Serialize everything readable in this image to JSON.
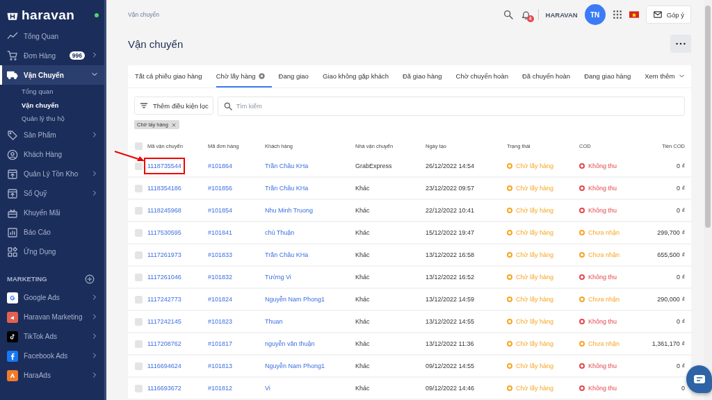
{
  "sidebar": {
    "logo": "haravan",
    "online": true,
    "items": [
      {
        "label": "Tổng Quan",
        "selected": false,
        "expandable": false
      },
      {
        "label": "Đơn Hàng",
        "selected": false,
        "expandable": true,
        "expanded": false,
        "badge": "996"
      },
      {
        "label": "Vận Chuyển",
        "selected": true,
        "expandable": true,
        "expanded": true,
        "children": [
          {
            "label": "Tổng quan",
            "selected": false
          },
          {
            "label": "Vận chuyển",
            "selected": true
          },
          {
            "label": "Quản lý thu hộ",
            "selected": false
          }
        ]
      },
      {
        "label": "Sản Phẩm",
        "selected": false,
        "expandable": true,
        "expanded": false
      },
      {
        "label": "Khách Hàng",
        "selected": false,
        "expandable": false
      },
      {
        "label": "Quản Lý Tồn Kho",
        "selected": false,
        "expandable": true,
        "expanded": false
      },
      {
        "label": "Sổ Quỹ",
        "selected": false,
        "expandable": true,
        "expanded": false
      },
      {
        "label": "Khuyến Mãi",
        "selected": false,
        "expandable": false
      },
      {
        "label": "Báo Cáo",
        "selected": false,
        "expandable": false
      },
      {
        "label": "Ứng Dụng",
        "selected": false,
        "expandable": false
      }
    ],
    "section_title": "MARKETING",
    "apps": [
      {
        "label": "Google Ads"
      },
      {
        "label": "Haravan Marketing"
      },
      {
        "label": "TikTok Ads"
      },
      {
        "label": "Facebook Ads"
      },
      {
        "label": "HaraAds"
      }
    ]
  },
  "topbar": {
    "breadcrumb": "Vận chuyển",
    "notifications": "4",
    "store": "HARAVAN",
    "avatar": "TN",
    "feedback": "Góp ý"
  },
  "page_title": "Vận chuyển",
  "tabs": [
    {
      "label": "Tất cả phiếu giao hàng",
      "selected": false
    },
    {
      "label": "Chờ lấy hàng",
      "selected": true
    },
    {
      "label": "Đang giao",
      "selected": false
    },
    {
      "label": "Giao không gặp khách",
      "selected": false
    },
    {
      "label": "Đã giao hàng",
      "selected": false
    },
    {
      "label": "Chờ chuyển hoàn",
      "selected": false
    },
    {
      "label": "Đã chuyển hoàn",
      "selected": false
    },
    {
      "label": "Đang giao hàng",
      "selected": false
    }
  ],
  "more_tab": "Xem thêm",
  "filter_button": "Thêm điều kiện lọc",
  "search": {
    "placeholder": "Tìm kiếm"
  },
  "chips": [
    "Chờ lấy hàng"
  ],
  "table": {
    "all_checked": false,
    "columns": [
      "Mã vận chuyển",
      "Mã đơn hàng",
      "Khách hàng",
      "Nhà vận chuyển",
      "Ngày tạo",
      "Trạng thái",
      "COD",
      "Tiền COD"
    ],
    "rows": [
      {
        "checked": false,
        "id": "1118735544",
        "order": "#101864",
        "customer": "Trần Châu KHa",
        "carrier": "GrabExpress",
        "date": "26/12/2022 14:54",
        "status": {
          "text": "Chờ lấy hàng",
          "color": "#f5a623"
        },
        "cod": {
          "text": "Không thu",
          "color": "#e5484d"
        },
        "amount": "0 ₫",
        "highlighted": true
      },
      {
        "checked": false,
        "id": "1118354186",
        "order": "#101856",
        "customer": "Trần Châu KHa",
        "carrier": "Khác",
        "date": "23/12/2022 09:57",
        "status": {
          "text": "Chờ lấy hàng",
          "color": "#f5a623"
        },
        "cod": {
          "text": "Không thu",
          "color": "#e5484d"
        },
        "amount": "0 ₫",
        "highlighted": false
      },
      {
        "checked": false,
        "id": "1118245968",
        "order": "#101854",
        "customer": "Nhu Minh Truong",
        "carrier": "Khác",
        "date": "22/12/2022 10:41",
        "status": {
          "text": "Chờ lấy hàng",
          "color": "#f5a623"
        },
        "cod": {
          "text": "Không thu",
          "color": "#e5484d"
        },
        "amount": "0 ₫",
        "highlighted": false
      },
      {
        "checked": false,
        "id": "1117530595",
        "order": "#101841",
        "customer": "chú Thuận",
        "carrier": "Khác",
        "date": "15/12/2022 19:47",
        "status": {
          "text": "Chờ lấy hàng",
          "color": "#f5a623"
        },
        "cod": {
          "text": "Chưa nhận",
          "color": "#f5a623"
        },
        "amount": "299,700 ₫",
        "highlighted": false
      },
      {
        "checked": false,
        "id": "1117261973",
        "order": "#101833",
        "customer": "Trần Châu KHa",
        "carrier": "Khác",
        "date": "13/12/2022 16:58",
        "status": {
          "text": "Chờ lấy hàng",
          "color": "#f5a623"
        },
        "cod": {
          "text": "Chưa nhận",
          "color": "#f5a623"
        },
        "amount": "655,500 ₫",
        "highlighted": false
      },
      {
        "checked": false,
        "id": "1117261046",
        "order": "#101832",
        "customer": "Tường Vi",
        "carrier": "Khác",
        "date": "13/12/2022 16:52",
        "status": {
          "text": "Chờ lấy hàng",
          "color": "#f5a623"
        },
        "cod": {
          "text": "Không thu",
          "color": "#e5484d"
        },
        "amount": "0 ₫",
        "highlighted": false
      },
      {
        "checked": false,
        "id": "1117242773",
        "order": "#101824",
        "customer": "Nguyễn Nam Phong1",
        "carrier": "Khác",
        "date": "13/12/2022 14:59",
        "status": {
          "text": "Chờ lấy hàng",
          "color": "#f5a623"
        },
        "cod": {
          "text": "Chưa nhận",
          "color": "#f5a623"
        },
        "amount": "290,000 ₫",
        "highlighted": false
      },
      {
        "checked": false,
        "id": "1117242145",
        "order": "#101823",
        "customer": "Thuan",
        "carrier": "Khác",
        "date": "13/12/2022 14:55",
        "status": {
          "text": "Chờ lấy hàng",
          "color": "#f5a623"
        },
        "cod": {
          "text": "Không thu",
          "color": "#e5484d"
        },
        "amount": "0 ₫",
        "highlighted": false
      },
      {
        "checked": false,
        "id": "1117208762",
        "order": "#101817",
        "customer": "nguyễn văn thuận",
        "carrier": "Khác",
        "date": "13/12/2022 11:36",
        "status": {
          "text": "Chờ lấy hàng",
          "color": "#f5a623"
        },
        "cod": {
          "text": "Chưa nhận",
          "color": "#f5a623"
        },
        "amount": "1,361,170 ₫",
        "highlighted": false
      },
      {
        "checked": false,
        "id": "1116694624",
        "order": "#101813",
        "customer": "Nguyễn Nam Phong1",
        "carrier": "Khác",
        "date": "09/12/2022 14:55",
        "status": {
          "text": "Chờ lấy hàng",
          "color": "#f5a623"
        },
        "cod": {
          "text": "Không thu",
          "color": "#e5484d"
        },
        "amount": "0 ₫",
        "highlighted": false
      },
      {
        "checked": false,
        "id": "1116693672",
        "order": "#101812",
        "customer": "Vi",
        "carrier": "Khác",
        "date": "09/12/2022 14:46",
        "status": {
          "text": "Chờ lấy hàng",
          "color": "#f5a623"
        },
        "cod": {
          "text": "Không thu",
          "color": "#e5484d"
        },
        "amount": "0",
        "highlighted": false
      }
    ]
  }
}
